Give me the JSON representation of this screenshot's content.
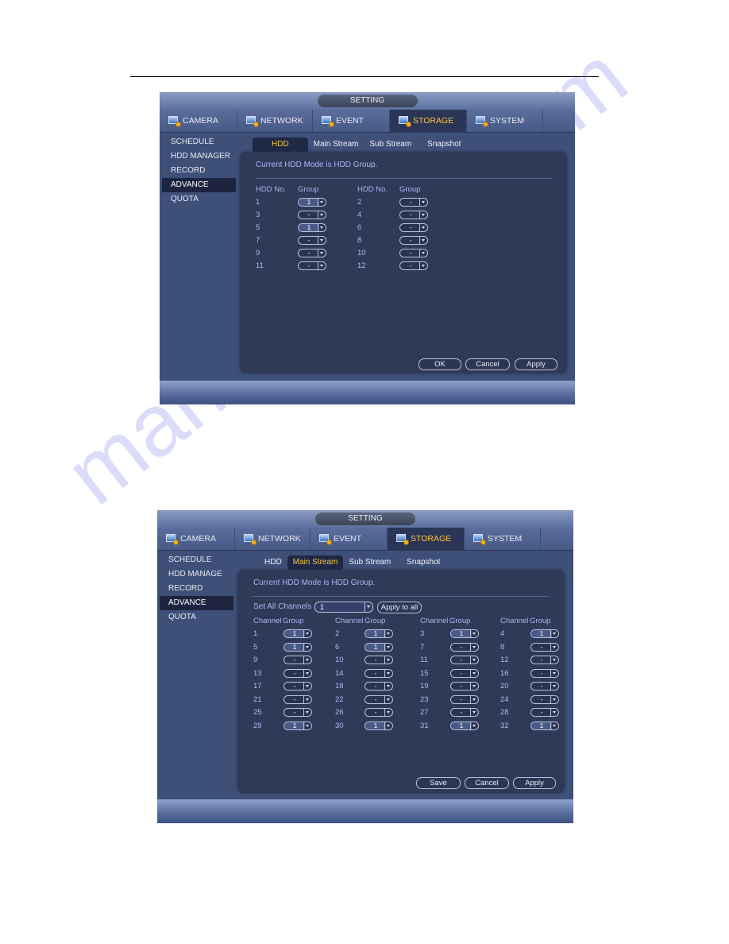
{
  "page": {
    "watermark": "manualshive.com"
  },
  "screens": [
    {
      "title": "SETTING",
      "nav_tabs": [
        {
          "label": "CAMERA",
          "icon": "camera-settings-icon"
        },
        {
          "label": "NETWORK",
          "icon": "network-icon"
        },
        {
          "label": "EVENT",
          "icon": "event-icon"
        },
        {
          "label": "STORAGE",
          "icon": "storage-icon",
          "active": true
        },
        {
          "label": "SYSTEM",
          "icon": "system-icon"
        }
      ],
      "sidebar": [
        "SCHEDULE",
        "HDD MANAGER",
        "RECORD",
        "ADVANCE",
        "QUOTA"
      ],
      "sidebar_active": "ADVANCE",
      "sub_tabs": [
        "HDD",
        "Main Stream",
        "Sub Stream",
        "Snapshot"
      ],
      "sub_tab_active": "HDD",
      "mode_text": "Current HDD Mode is HDD Group.",
      "headers": {
        "no": "HDD No.",
        "group": "Group"
      },
      "rows": [
        {
          "no": "1",
          "group": "1"
        },
        {
          "no": "2",
          "group": "-"
        },
        {
          "no": "3",
          "group": "-"
        },
        {
          "no": "4",
          "group": "-"
        },
        {
          "no": "5",
          "group": "1"
        },
        {
          "no": "6",
          "group": "-"
        },
        {
          "no": "7",
          "group": "-"
        },
        {
          "no": "8",
          "group": "-"
        },
        {
          "no": "9",
          "group": "-"
        },
        {
          "no": "10",
          "group": "-"
        },
        {
          "no": "11",
          "group": "-"
        },
        {
          "no": "12",
          "group": "-"
        }
      ],
      "buttons": [
        "OK",
        "Cancel",
        "Apply"
      ]
    },
    {
      "title": "SETTING",
      "nav_tabs": [
        {
          "label": "CAMERA",
          "icon": "camera-settings-icon"
        },
        {
          "label": "NETWORK",
          "icon": "network-icon"
        },
        {
          "label": "EVENT",
          "icon": "event-icon"
        },
        {
          "label": "STORAGE",
          "icon": "storage-icon",
          "active": true
        },
        {
          "label": "SYSTEM",
          "icon": "system-icon"
        }
      ],
      "sidebar": [
        "SCHEDULE",
        "HDD MANAGE",
        "RECORD",
        "ADVANCE",
        "QUOTA"
      ],
      "sidebar_active": "ADVANCE",
      "sub_tabs": [
        "HDD",
        "Main Stream",
        "Sub Stream",
        "Snapshot"
      ],
      "sub_tab_active": "Main Stream",
      "mode_text": "Current HDD Mode is HDD Group.",
      "set_all": {
        "label": "Set All Channels",
        "value": "1",
        "apply_label": "Apply to all"
      },
      "headers": {
        "no": "Channel",
        "group": "Group"
      },
      "rows": [
        {
          "no": "1",
          "group": "1"
        },
        {
          "no": "2",
          "group": "1"
        },
        {
          "no": "3",
          "group": "1"
        },
        {
          "no": "4",
          "group": "1"
        },
        {
          "no": "5",
          "group": "1"
        },
        {
          "no": "6",
          "group": "1"
        },
        {
          "no": "7",
          "group": "-"
        },
        {
          "no": "8",
          "group": "-"
        },
        {
          "no": "9",
          "group": "-"
        },
        {
          "no": "10",
          "group": "-"
        },
        {
          "no": "11",
          "group": "-"
        },
        {
          "no": "12",
          "group": "-"
        },
        {
          "no": "13",
          "group": "-"
        },
        {
          "no": "14",
          "group": "-"
        },
        {
          "no": "15",
          "group": "-"
        },
        {
          "no": "16",
          "group": "-"
        },
        {
          "no": "17",
          "group": "-"
        },
        {
          "no": "18",
          "group": "-"
        },
        {
          "no": "19",
          "group": "-"
        },
        {
          "no": "20",
          "group": "-"
        },
        {
          "no": "21",
          "group": "-"
        },
        {
          "no": "22",
          "group": "-"
        },
        {
          "no": "23",
          "group": "-"
        },
        {
          "no": "24",
          "group": "-"
        },
        {
          "no": "25",
          "group": "-"
        },
        {
          "no": "26",
          "group": "-"
        },
        {
          "no": "27",
          "group": "-"
        },
        {
          "no": "28",
          "group": "-"
        },
        {
          "no": "29",
          "group": "1"
        },
        {
          "no": "30",
          "group": "1"
        },
        {
          "no": "31",
          "group": "1"
        },
        {
          "no": "32",
          "group": "1"
        }
      ],
      "buttons": [
        "Save",
        "Cancel",
        "Apply"
      ]
    }
  ]
}
